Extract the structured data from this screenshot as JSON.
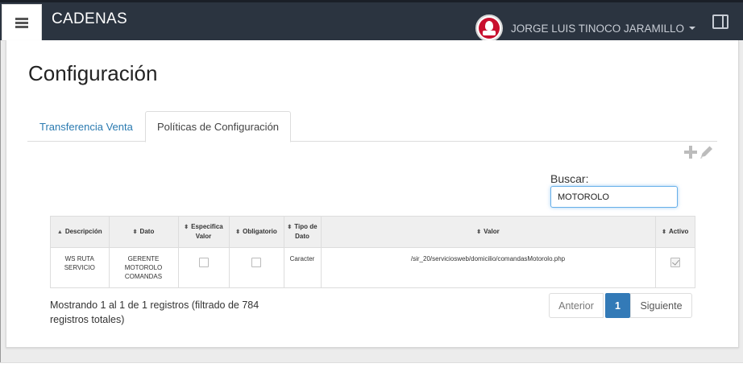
{
  "navbar": {
    "brand": "CADENAS",
    "user_name": "JORGE LUIS TINOCO JARAMILLO",
    "icons": {
      "menu": "hamburger-icon",
      "avatar": "kfc-logo",
      "panel": "panel-toggle-icon"
    }
  },
  "page": {
    "title": "Configuración"
  },
  "tabs": [
    {
      "label": "Transferencia Venta",
      "active": false
    },
    {
      "label": "Políticas de Configuración",
      "active": true
    }
  ],
  "toolbar": {
    "icons": [
      "plus-icon",
      "pencil-icon"
    ]
  },
  "search": {
    "label": "Buscar:",
    "value": "MOTOROLO"
  },
  "table": {
    "columns": [
      {
        "label": "Descripción",
        "sort": "▲"
      },
      {
        "label": "Dato",
        "sort": "⬍"
      },
      {
        "label": "Especifica Valor",
        "sort": "⬍"
      },
      {
        "label": "Obligatorio",
        "sort": "⬍"
      },
      {
        "label": "Tipo de Dato",
        "sort": "⬍"
      },
      {
        "label": "Valor",
        "sort": "⬍"
      },
      {
        "label": "Activo",
        "sort": "⬍"
      }
    ],
    "rows": [
      {
        "descripcion": "WS RUTA SERVICIO",
        "dato": "GERENTE MOTOROLO COMANDAS",
        "especifica_valor": false,
        "obligatorio": false,
        "tipo_dato": "Caracter",
        "valor": "/sir_20/serviciosweb/domicilio/comandasMotorolo.php",
        "activo": true
      }
    ]
  },
  "info": "Mostrando 1 al 1 de 1 registros (filtrado de 784 registros totales)",
  "pagination": {
    "prev": "Anterior",
    "current": "1",
    "next": "Siguiente"
  },
  "colors": {
    "navbar": "#2b3440",
    "link": "#2a7ab0",
    "accent": "#337ab7"
  }
}
